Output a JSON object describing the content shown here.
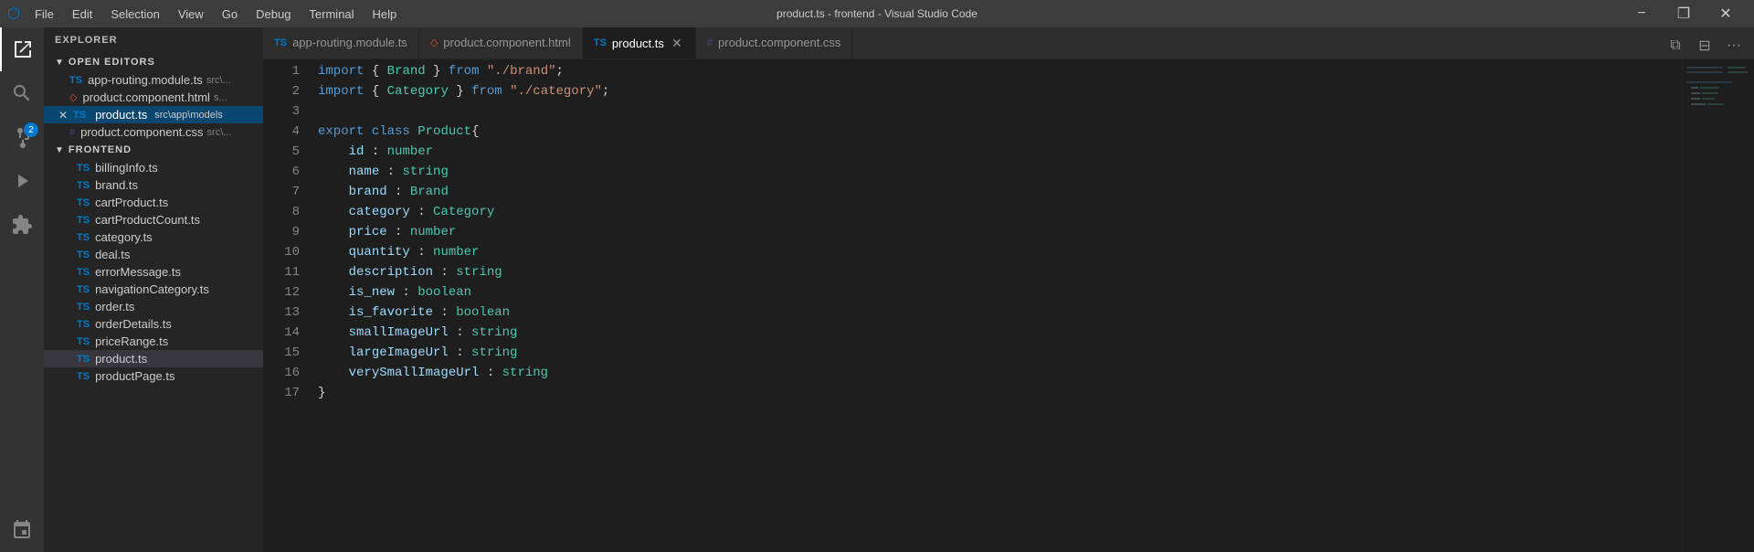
{
  "titleBar": {
    "title": "product.ts - frontend - Visual Studio Code",
    "menuItems": [
      "File",
      "Edit",
      "Selection",
      "View",
      "Go",
      "Debug",
      "Terminal",
      "Help"
    ],
    "minimizeLabel": "−",
    "maximizeLabel": "❐",
    "closeLabel": "✕"
  },
  "activityBar": {
    "items": [
      {
        "name": "explorer",
        "icon": "⬜",
        "label": "Explorer"
      },
      {
        "name": "search",
        "icon": "🔍",
        "label": "Search"
      },
      {
        "name": "source-control",
        "icon": "⑂",
        "label": "Source Control"
      },
      {
        "name": "run",
        "icon": "▷",
        "label": "Run"
      },
      {
        "name": "extensions",
        "icon": "⧉",
        "label": "Extensions"
      },
      {
        "name": "remote",
        "icon": "⊞",
        "label": "Remote"
      }
    ],
    "badge": "2"
  },
  "sidebar": {
    "title": "EXPLORER",
    "openEditors": {
      "label": "OPEN EDITORS",
      "files": [
        {
          "name": "app-routing.module.ts",
          "path": "src\\...",
          "type": "ts",
          "dirty": false
        },
        {
          "name": "product.component.html",
          "path": "s...",
          "type": "html",
          "dirty": false
        },
        {
          "name": "product.ts",
          "path": "src\\app\\models",
          "type": "ts",
          "dirty": false,
          "active": true,
          "hasClose": true
        },
        {
          "name": "product.component.css",
          "path": "src\\...",
          "type": "css",
          "dirty": false
        }
      ]
    },
    "frontend": {
      "label": "FRONTEND",
      "files": [
        "billingInfo.ts",
        "brand.ts",
        "cartProduct.ts",
        "cartProductCount.ts",
        "category.ts",
        "deal.ts",
        "errorMessage.ts",
        "navigationCategory.ts",
        "order.ts",
        "orderDetails.ts",
        "priceRange.ts",
        "product.ts",
        "productPage.ts"
      ]
    }
  },
  "tabs": [
    {
      "name": "app-routing.module.ts",
      "type": "ts",
      "active": false
    },
    {
      "name": "product.component.html",
      "type": "html",
      "active": false
    },
    {
      "name": "product.ts",
      "type": "ts",
      "active": true,
      "hasClose": true
    },
    {
      "name": "product.component.css",
      "type": "css",
      "active": false
    }
  ],
  "editor": {
    "filename": "product.ts",
    "lines": [
      {
        "num": 1,
        "tokens": [
          {
            "t": "kw",
            "v": "import"
          },
          {
            "t": "plain",
            "v": " { "
          },
          {
            "t": "cl",
            "v": "Brand"
          },
          {
            "t": "plain",
            "v": " } "
          },
          {
            "t": "kw",
            "v": "from"
          },
          {
            "t": "plain",
            "v": " "
          },
          {
            "t": "str",
            "v": "\"./brand\""
          },
          {
            "t": "plain",
            "v": ";"
          }
        ]
      },
      {
        "num": 2,
        "tokens": [
          {
            "t": "kw",
            "v": "import"
          },
          {
            "t": "plain",
            "v": " { "
          },
          {
            "t": "cl",
            "v": "Category"
          },
          {
            "t": "plain",
            "v": " } "
          },
          {
            "t": "kw",
            "v": "from"
          },
          {
            "t": "plain",
            "v": " "
          },
          {
            "t": "str",
            "v": "\"./category\""
          },
          {
            "t": "plain",
            "v": ";"
          }
        ]
      },
      {
        "num": 3,
        "tokens": []
      },
      {
        "num": 4,
        "tokens": [
          {
            "t": "kw",
            "v": "export"
          },
          {
            "t": "plain",
            "v": " "
          },
          {
            "t": "kw",
            "v": "class"
          },
          {
            "t": "plain",
            "v": " "
          },
          {
            "t": "cl",
            "v": "Product"
          },
          {
            "t": "plain",
            "v": "{"
          }
        ]
      },
      {
        "num": 5,
        "tokens": [
          {
            "t": "plain",
            "v": "    "
          },
          {
            "t": "prop",
            "v": "id"
          },
          {
            "t": "plain",
            "v": " : "
          },
          {
            "t": "type",
            "v": "number"
          }
        ]
      },
      {
        "num": 6,
        "tokens": [
          {
            "t": "plain",
            "v": "    "
          },
          {
            "t": "prop",
            "v": "name"
          },
          {
            "t": "plain",
            "v": " : "
          },
          {
            "t": "type",
            "v": "string"
          }
        ]
      },
      {
        "num": 7,
        "tokens": [
          {
            "t": "plain",
            "v": "    "
          },
          {
            "t": "prop",
            "v": "brand"
          },
          {
            "t": "plain",
            "v": " : "
          },
          {
            "t": "type",
            "v": "Brand"
          }
        ]
      },
      {
        "num": 8,
        "tokens": [
          {
            "t": "plain",
            "v": "    "
          },
          {
            "t": "prop",
            "v": "category"
          },
          {
            "t": "plain",
            "v": " : "
          },
          {
            "t": "type",
            "v": "Category"
          }
        ]
      },
      {
        "num": 9,
        "tokens": [
          {
            "t": "plain",
            "v": "    "
          },
          {
            "t": "prop",
            "v": "price"
          },
          {
            "t": "plain",
            "v": " : "
          },
          {
            "t": "type",
            "v": "number"
          }
        ]
      },
      {
        "num": 10,
        "tokens": [
          {
            "t": "plain",
            "v": "    "
          },
          {
            "t": "prop",
            "v": "quantity"
          },
          {
            "t": "plain",
            "v": " : "
          },
          {
            "t": "type",
            "v": "number"
          }
        ]
      },
      {
        "num": 11,
        "tokens": [
          {
            "t": "plain",
            "v": "    "
          },
          {
            "t": "prop",
            "v": "description"
          },
          {
            "t": "plain",
            "v": " : "
          },
          {
            "t": "type",
            "v": "string"
          }
        ]
      },
      {
        "num": 12,
        "tokens": [
          {
            "t": "plain",
            "v": "    "
          },
          {
            "t": "prop",
            "v": "is_new"
          },
          {
            "t": "plain",
            "v": " : "
          },
          {
            "t": "type",
            "v": "boolean"
          }
        ]
      },
      {
        "num": 13,
        "tokens": [
          {
            "t": "plain",
            "v": "    "
          },
          {
            "t": "prop",
            "v": "is_favorite"
          },
          {
            "t": "plain",
            "v": " : "
          },
          {
            "t": "type",
            "v": "boolean"
          }
        ]
      },
      {
        "num": 14,
        "tokens": [
          {
            "t": "plain",
            "v": "    "
          },
          {
            "t": "prop",
            "v": "smallImageUrl"
          },
          {
            "t": "plain",
            "v": " : "
          },
          {
            "t": "type",
            "v": "string"
          }
        ]
      },
      {
        "num": 15,
        "tokens": [
          {
            "t": "plain",
            "v": "    "
          },
          {
            "t": "prop",
            "v": "largeImageUrl"
          },
          {
            "t": "plain",
            "v": " : "
          },
          {
            "t": "type",
            "v": "string"
          }
        ]
      },
      {
        "num": 16,
        "tokens": [
          {
            "t": "plain",
            "v": "    "
          },
          {
            "t": "prop",
            "v": "verySmallImageUrl"
          },
          {
            "t": "plain",
            "v": " : "
          },
          {
            "t": "type",
            "v": "string"
          }
        ]
      },
      {
        "num": 17,
        "tokens": [
          {
            "t": "plain",
            "v": "}"
          }
        ]
      }
    ]
  }
}
